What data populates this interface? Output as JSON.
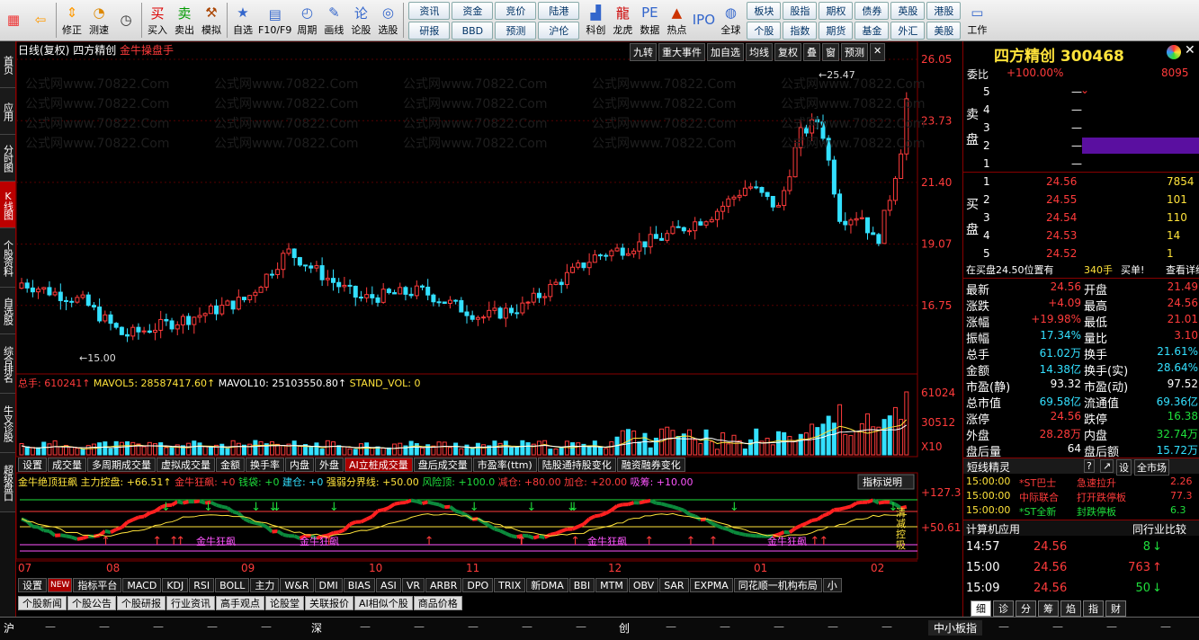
{
  "toolbar": {
    "left": [
      {
        "label": "",
        "icon": "windows-logo"
      },
      {
        "label": "",
        "icon": "back-arrow"
      },
      {
        "label": "修正",
        "icon": "up-down-arrows"
      },
      {
        "label": "测速",
        "icon": "speedometer"
      },
      {
        "label": "",
        "icon": "clock"
      },
      {
        "label": "买入",
        "icon": "buy"
      },
      {
        "label": "卖出",
        "icon": "sell"
      },
      {
        "label": "模拟",
        "icon": "hammer"
      },
      {
        "label": "自选",
        "icon": "star-folder"
      },
      {
        "label": "F10/F9",
        "icon": "screen"
      },
      {
        "label": "周期",
        "icon": "clock-dial"
      },
      {
        "label": "画线",
        "icon": "pencil"
      },
      {
        "label": "论股",
        "icon": "speech"
      },
      {
        "label": "选股",
        "icon": "chart-circle"
      }
    ],
    "grid1": [
      "资讯",
      "资金",
      "竞价",
      "陆港",
      "",
      "",
      "",
      "",
      "研报",
      "BBD",
      "预测",
      "沪伦",
      "",
      "",
      "",
      ""
    ],
    "mid": [
      {
        "label": "科创",
        "icon": "kechuang"
      },
      {
        "label": "龙虎",
        "icon": "dragon"
      },
      {
        "label": "数据",
        "icon": "pe"
      },
      {
        "label": "热点",
        "icon": "hot"
      },
      {
        "label": "",
        "icon": "ipo"
      },
      {
        "label": "全球",
        "icon": "globe"
      }
    ],
    "grid2": [
      "板块",
      "股指",
      "期权",
      "债券",
      "英股",
      "港股",
      "个股",
      "指数",
      "期货",
      "基金",
      "外汇",
      "美股"
    ],
    "right": {
      "label": "工作"
    }
  },
  "lefttabs": [
    "首页",
    "应用",
    "分时图",
    "K线图",
    "个股资料",
    "自选股",
    "综合排名",
    "牛叉诊股",
    "超级盘口"
  ],
  "chart": {
    "header_main": "日线(复权)",
    "header_name": "四方精创",
    "header_indicator": "金牛操盘手",
    "buttons": [
      "九转",
      "重大事件",
      "加自选",
      "均线",
      "复权",
      "叠",
      "窗",
      "预测"
    ],
    "price_labels": [
      "26.05",
      "23.73",
      "21.40",
      "19.07",
      "16.75"
    ],
    "high_label": "25.47",
    "low_label": "15.00",
    "vol_header": {
      "total": "总手: 610241↑",
      "mavol5": "MAVOL5: 28587417.60↑",
      "mavol10": "MAVOL10: 25103550.80↑",
      "stand": "STAND_VOL: 0"
    },
    "vol_labels": [
      "61024",
      "30512",
      "X10"
    ],
    "tabs1": [
      "设置",
      "成交量",
      "多周期成交量",
      "虚拟成交量",
      "金额",
      "换手率",
      "内盘",
      "外盘",
      "AI立桩成交量",
      "盘后成交量",
      "市盈率(ttm)",
      "陆股通持股变化",
      "融资融券变化"
    ],
    "ind_header": {
      "name": "金牛绝顶狂飙",
      "main": "主力控盘: +66.51↑",
      "kb": "金牛狂飙: +0",
      "qd": "钱袋: +0",
      "jc": "建仓: +0",
      "qr": "强弱分界线: +50.00",
      "fx": "风险顶: +100.0",
      "jc2": "减仓: +80.00",
      "jc3": "加仓: +20.00",
      "xc": "吸筹: +10.00"
    },
    "ind_help": "指标说明",
    "ind_labels": [
      "+127.3",
      "+50.61"
    ],
    "ind_side": [
      "清",
      "减",
      "控",
      "吸"
    ],
    "ind_text": "金牛狂飙",
    "months": [
      "07",
      "08",
      "09",
      "10",
      "11",
      "12",
      "01",
      "02"
    ],
    "tabs2_new": "NEW",
    "tabs2": [
      "设置",
      "指标平台",
      "MACD",
      "KDJ",
      "RSI",
      "BOLL",
      "主力",
      "W&R",
      "DMI",
      "BIAS",
      "ASI",
      "VR",
      "ARBR",
      "DPO",
      "TRIX",
      "新DMA",
      "BBI",
      "MTM",
      "OBV",
      "SAR",
      "EXPMA",
      "同花顺一机构布局",
      "小"
    ],
    "tabs3": [
      "个股新闻",
      "个股公告",
      "个股研报",
      "行业资讯",
      "高手观点",
      "论股堂",
      "关联报价",
      "AI相似个股",
      "商品价格"
    ]
  },
  "right": {
    "title": "四方精创 300468",
    "weibi_label": "委比",
    "weibi": "+100.00%",
    "weicha": "8095",
    "sell_label": "卖盘",
    "buy_label": "买盘",
    "sell": [
      {
        "lv": "5",
        "p": "—",
        "v": ""
      },
      {
        "lv": "4",
        "p": "—",
        "v": ""
      },
      {
        "lv": "3",
        "p": "—",
        "v": ""
      },
      {
        "lv": "2",
        "p": "—",
        "v": ""
      },
      {
        "lv": "1",
        "p": "—",
        "v": ""
      }
    ],
    "buy": [
      {
        "lv": "1",
        "p": "24.56",
        "v": "7854"
      },
      {
        "lv": "2",
        "p": "24.55",
        "v": "101"
      },
      {
        "lv": "3",
        "p": "24.54",
        "v": "110"
      },
      {
        "lv": "4",
        "p": "24.53",
        "v": "14"
      },
      {
        "lv": "5",
        "p": "24.52",
        "v": "1"
      }
    ],
    "notice": "在买盘24.50位置有",
    "notice_v": "340手",
    "notice_b": "买单!",
    "notice_d": "查看详细",
    "stats": [
      [
        "最新",
        "24.56",
        "开盘",
        "21.49"
      ],
      [
        "涨跌",
        "+4.09",
        "最高",
        "24.56"
      ],
      [
        "涨幅",
        "+19.98%",
        "最低",
        "21.01"
      ],
      [
        "振幅",
        "17.34%",
        "量比",
        "3.10"
      ],
      [
        "总手",
        "61.02万",
        "换手",
        "21.61%"
      ],
      [
        "金额",
        "14.38亿",
        "换手(实)",
        "28.64%"
      ],
      [
        "市盈(静)",
        "93.32",
        "市盈(动)",
        "97.52"
      ],
      [
        "总市值",
        "69.58亿",
        "流通值",
        "69.36亿"
      ],
      [
        "涨停",
        "24.56",
        "跌停",
        "16.38"
      ],
      [
        "外盘",
        "28.28万",
        "内盘",
        "32.74万"
      ],
      [
        "盘后量",
        "64",
        "盘后额",
        "15.72万"
      ]
    ],
    "short_title": "短线精灵",
    "short_btns": [
      "?",
      "↗",
      "设",
      "全市场"
    ],
    "short": [
      {
        "t": "15:00:00",
        "n": "*ST巴士",
        "e": "急速拉升",
        "v": "2.26"
      },
      {
        "t": "15:00:00",
        "n": "中际联合",
        "e": "打开跌停板",
        "v": "77.3"
      },
      {
        "t": "15:00:00",
        "n": "*ST全新",
        "e": "封跌停板",
        "v": "6.3"
      }
    ],
    "industry": "计算机应用",
    "industry_btn": "同行业比较",
    "ticks": [
      {
        "t": "14:57",
        "p": "24.56",
        "v": "8",
        "d": "↓"
      },
      {
        "t": "15:00",
        "p": "24.56",
        "v": "763",
        "d": "↑"
      },
      {
        "t": "15:09",
        "p": "24.56",
        "v": "50",
        "d": "↓"
      }
    ],
    "bottom_tabs": [
      "细",
      "诊",
      "分",
      "筹",
      "焰",
      "指",
      "财"
    ]
  },
  "status": {
    "sh": "沪",
    "sz": "深",
    "cy": "创",
    "zx": "中小板指",
    "dash": "—"
  },
  "colors": {
    "up": "#ff3b3b",
    "down": "#1fdf3c",
    "cyan": "#33e0ff",
    "yellow": "#ffe33b"
  }
}
